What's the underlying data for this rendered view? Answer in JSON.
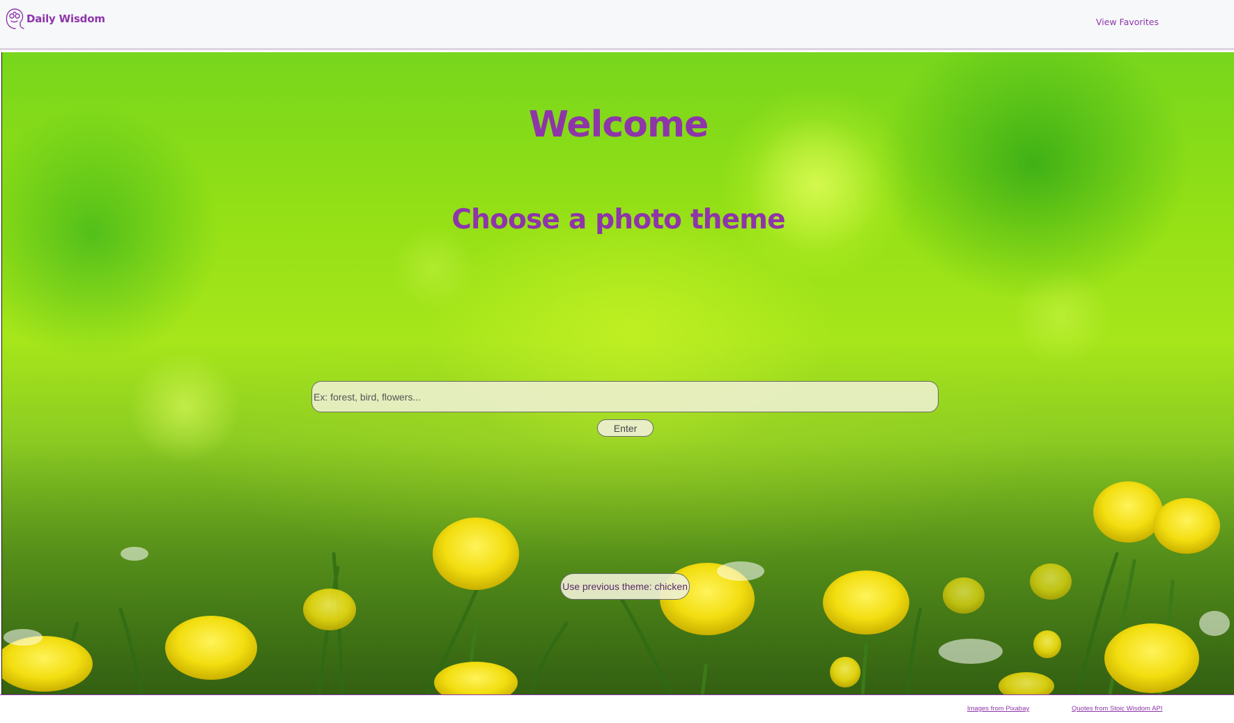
{
  "header": {
    "brand_name": "Daily Wisdom",
    "brand_logo_icon": "head-face-outline-icon",
    "favorites_link": "View Favorites"
  },
  "hero": {
    "background": "green-meadow-yellow-flowers-photo",
    "title": "Welcome",
    "subtitle": "Choose a photo theme",
    "search": {
      "placeholder": "Ex: forest, bird, flowers...",
      "value": ""
    },
    "enter_label": "Enter",
    "previous_theme_label": "Use previous theme: chicken"
  },
  "footer": {
    "images_credit": "Images from Pixabay",
    "quotes_credit": "Quotes from Stoic Wisdom API"
  },
  "colors": {
    "accent": "#8e35a9",
    "navbar_bg": "#f6f8fa",
    "input_bg": "#eef0d2"
  }
}
